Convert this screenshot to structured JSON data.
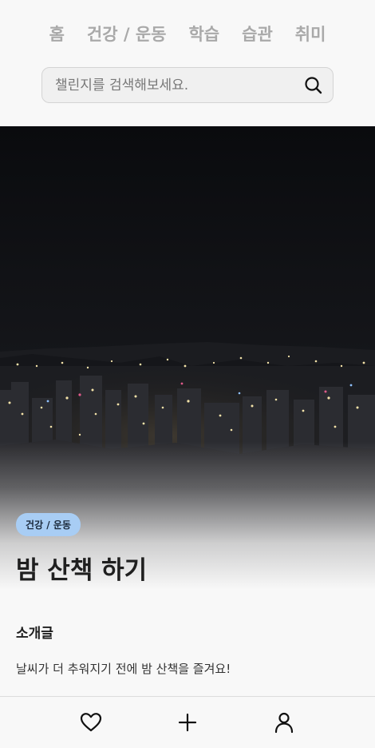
{
  "nav": {
    "tabs": [
      {
        "label": "홈"
      },
      {
        "label": "건강 / 운동"
      },
      {
        "label": "학습"
      },
      {
        "label": "습관"
      },
      {
        "label": "취미"
      }
    ]
  },
  "search": {
    "placeholder": "챌린지를 검색해보세요.",
    "value": "",
    "icon": "search-icon"
  },
  "challenge": {
    "category": "건강 / 운동",
    "title": "밤 산책 하기",
    "image": "night-city-skyline"
  },
  "intro": {
    "heading": "소개글",
    "text": "날씨가 더 추워지기 전에 밤 산책을 즐겨요!"
  },
  "bottom_nav": {
    "items": [
      {
        "icon": "heart-icon"
      },
      {
        "icon": "plus-icon"
      },
      {
        "icon": "user-icon"
      }
    ]
  },
  "colors": {
    "background": "#f8f8f8",
    "tab_inactive": "#a9a9a9",
    "badge_bg": "#a8cdf4",
    "text_primary": "#1f1f1f"
  }
}
